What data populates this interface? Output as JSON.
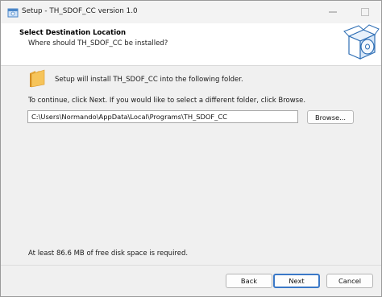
{
  "window": {
    "title": "Setup - TH_SDOF_CC version 1.0"
  },
  "header": {
    "title": "Select Destination Location",
    "subtitle": "Where should TH_SDOF_CC be installed?"
  },
  "main": {
    "intro": "Setup will install TH_SDOF_CC into the following folder.",
    "instruction": "To continue, click Next. If you would like to select a different folder, click Browse.",
    "install_path": "C:\\Users\\Normando\\AppData\\Local\\Programs\\TH_SDOF_CC",
    "browse_label": "Browse...",
    "disk_space": "At least 86.6 MB of free disk space is required."
  },
  "footer": {
    "back_label": "Back",
    "next_label": "Next",
    "cancel_label": "Cancel"
  },
  "colors": {
    "accent": "#3a78c7",
    "folder": "#f0b94a",
    "header_bg": "#ffffff",
    "window_bg": "#f0f0f0"
  },
  "icons": {
    "app": "setup-app-icon",
    "minimize": "minimize-icon",
    "maximize": "maximize-icon",
    "close": "close-icon",
    "wizard": "software-box-disc-icon",
    "folder": "folder-icon"
  }
}
